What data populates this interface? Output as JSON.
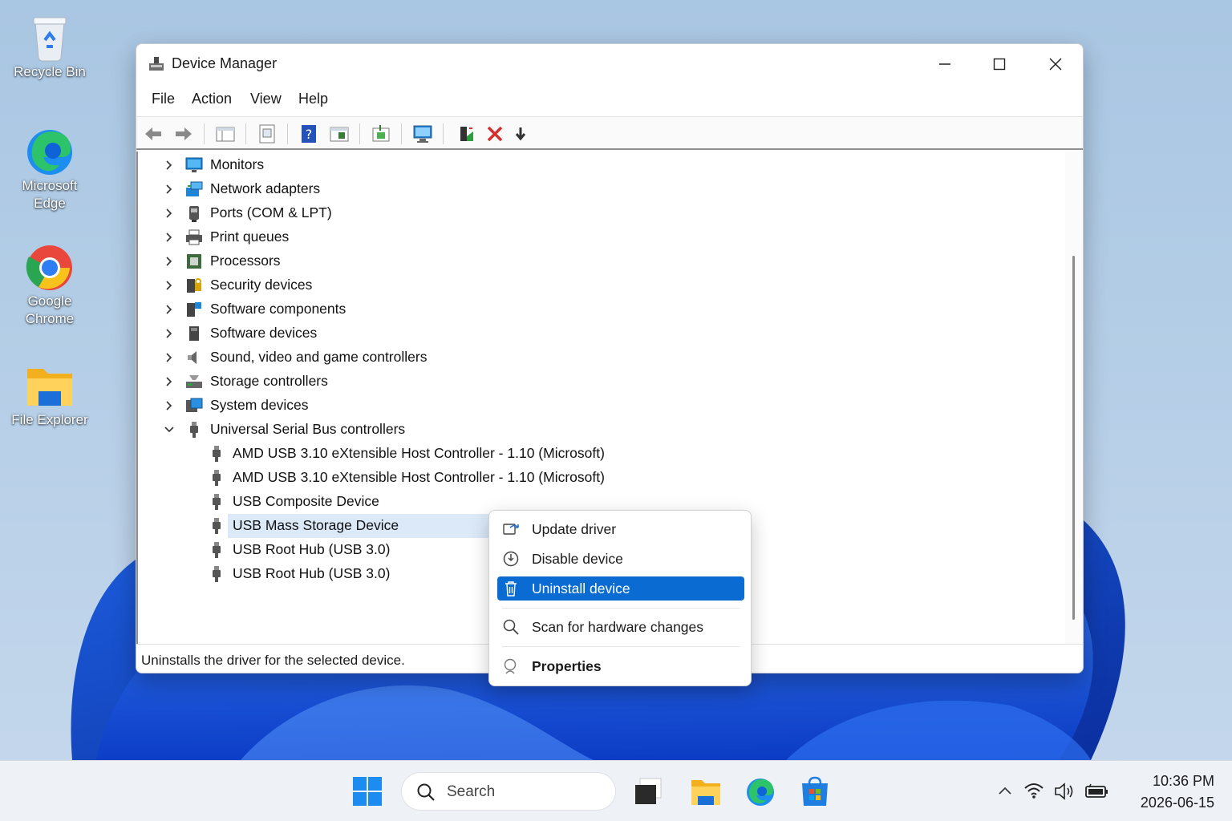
{
  "desktop": {
    "icons": [
      {
        "label": "Recycle Bin",
        "icon": "recycle-bin-icon"
      },
      {
        "label_line1": "Microsoft",
        "label_line2": "Edge",
        "icon": "edge-icon"
      },
      {
        "label_line1": "Google",
        "label_line2": "Chrome",
        "icon": "chrome-icon"
      },
      {
        "label": "File Explorer",
        "icon": "folder-icon"
      }
    ]
  },
  "window": {
    "title": "Device Manager",
    "menu": [
      "File",
      "Action",
      "View",
      "Help"
    ],
    "toolbar": [
      "back-icon",
      "forward-icon",
      "show-hide-console-tree-icon",
      "properties-icon",
      "help-icon",
      "action-pane-icon",
      "update-driver-icon",
      "scan-hardware-icon",
      "add-legacy-hardware-icon",
      "uninstall-device-icon",
      "disable-icon"
    ]
  },
  "tree": {
    "categories": [
      {
        "label": "Monitors",
        "icon": "monitor-icon"
      },
      {
        "label": "Network adapters",
        "icon": "network-adapter-icon"
      },
      {
        "label": "Ports (COM & LPT)",
        "icon": "port-icon"
      },
      {
        "label": "Print queues",
        "icon": "printer-icon"
      },
      {
        "label": "Processors",
        "icon": "processor-icon"
      },
      {
        "label": "Security devices",
        "icon": "security-device-icon"
      },
      {
        "label": "Software components",
        "icon": "software-component-icon"
      },
      {
        "label": "Software devices",
        "icon": "software-device-icon"
      },
      {
        "label": "Sound, video and game controllers",
        "icon": "speaker-icon"
      },
      {
        "label": "Storage controllers",
        "icon": "storage-controller-icon"
      },
      {
        "label": "System devices",
        "icon": "system-device-icon"
      }
    ],
    "expanded": {
      "label": "Universal Serial Bus controllers",
      "icon": "usb-icon",
      "children": [
        "AMD USB 3.10 eXtensible Host Controller - 1.10 (Microsoft)",
        "AMD USB 3.10 eXtensible Host Controller - 1.10 (Microsoft)",
        "USB Composite Device",
        "USB Mass Storage Device",
        "USB Root Hub (USB 3.0)",
        "USB Root Hub (USB 3.0)"
      ],
      "selected": "USB Mass Storage Device"
    }
  },
  "status": "Uninstalls the driver for the selected device.",
  "context_menu": {
    "items": [
      {
        "label": "Update driver",
        "icon": "update-driver-icon"
      },
      {
        "label": "Disable device",
        "icon": "disable-device-icon"
      },
      {
        "label": "Uninstall device",
        "icon": "trash-icon",
        "active": true
      },
      {
        "label": "Scan for hardware changes",
        "icon": "scan-icon"
      },
      {
        "label": "Properties",
        "icon": "properties-icon",
        "bold": true
      }
    ]
  },
  "taskbar": {
    "search_placeholder": "Search",
    "apps": [
      "start-icon",
      "task-view-icon",
      "file-explorer-icon",
      "edge-icon",
      "store-icon"
    ],
    "tray": [
      "chevron-up-icon",
      "wifi-icon",
      "volume-icon",
      "battery-icon"
    ],
    "time": "10:36 PM",
    "date": "2026-06-15"
  },
  "colors": {
    "accent": "#0a6cd3",
    "selection": "#dbe9f9",
    "uninstall_red": "#d32f2f"
  }
}
